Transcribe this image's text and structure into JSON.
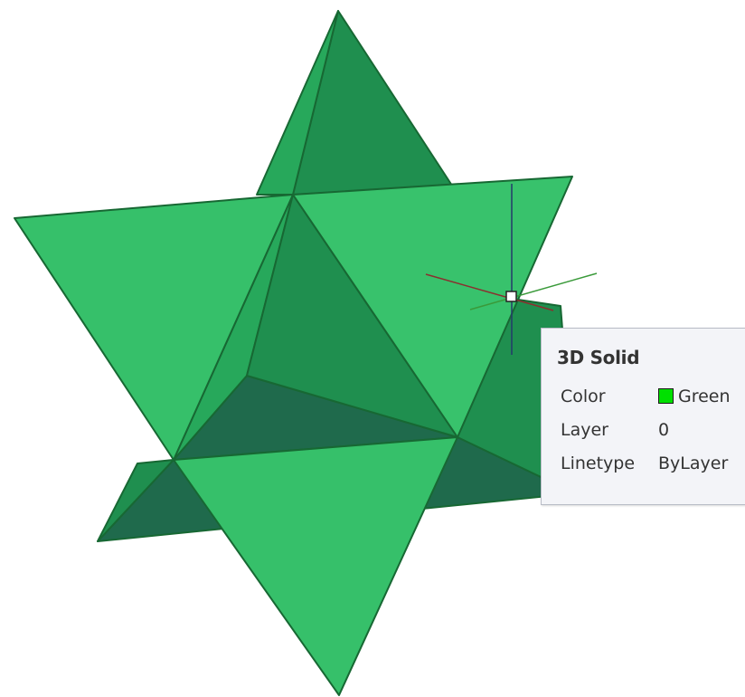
{
  "viewport": {
    "object": "stellated octahedron 3D solid",
    "colors": {
      "light_face": "#36c06a",
      "mid_face": "#1f8f4f",
      "dark_face": "#1f6a4c",
      "edge": "#176833",
      "background": "#ffffff"
    }
  },
  "crosshair": {
    "x_axis_color": "#8b2f2f",
    "y_axis_color": "#3a9a3a",
    "z_axis_color": "#243a6b"
  },
  "tooltip": {
    "title": "3D Solid",
    "rows": [
      {
        "label": "Color",
        "value": "Green",
        "swatch_color": "#00e000"
      },
      {
        "label": "Layer",
        "value": "0"
      },
      {
        "label": "Linetype",
        "value": "ByLayer"
      }
    ]
  }
}
